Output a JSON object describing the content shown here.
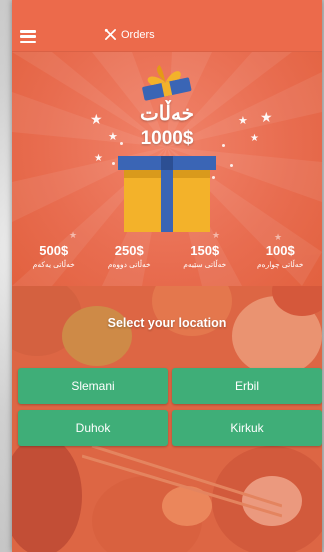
{
  "header": {
    "title": "Orders",
    "title_icon": "fork-knife-icon",
    "menu_icon": "hamburger-menu-icon"
  },
  "grand_prize": {
    "label": "خەڵات",
    "amount": "1000$"
  },
  "prizes": [
    {
      "amount": "500$",
      "label": "خەڵاتی یەکەم"
    },
    {
      "amount": "250$",
      "label": "خەڵاتی دووەم"
    },
    {
      "amount": "150$",
      "label": "خەڵاتی سێیەم"
    },
    {
      "amount": "100$",
      "label": "خەڵاتی چوارەم"
    }
  ],
  "location": {
    "title": "Select your location",
    "options": [
      "Slemani",
      "Erbil",
      "Duhok",
      "Kirkuk"
    ]
  },
  "colors": {
    "accent": "#ec6a4b",
    "button": "#3fae78",
    "gift_box": "#f3b22a",
    "gift_ribbon": "#3a65b5"
  }
}
